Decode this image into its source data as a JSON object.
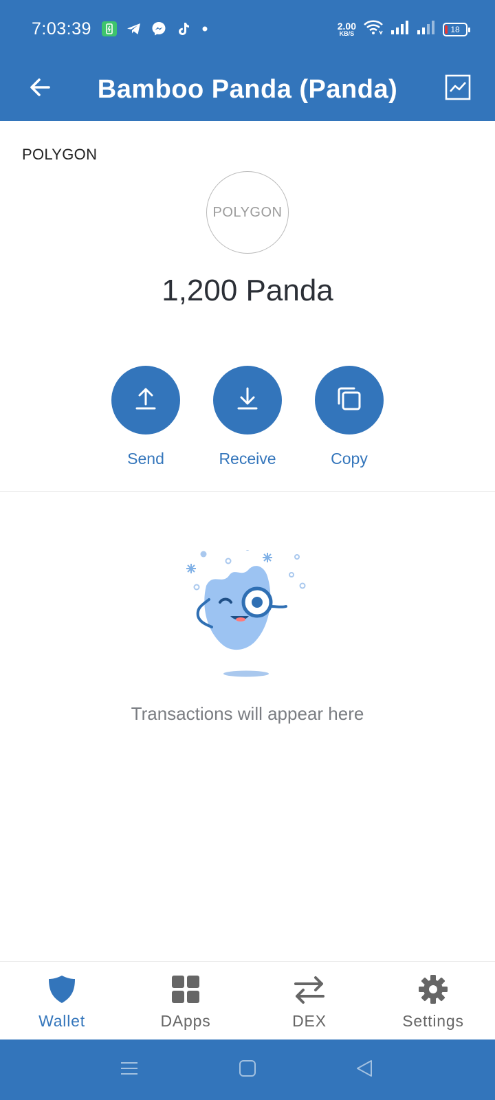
{
  "status_bar": {
    "time": "7:03:39",
    "net_speed_value": "2.00",
    "net_speed_unit": "KB/S",
    "battery": "18",
    "icons": [
      "battery-saver-icon",
      "telegram-icon",
      "messenger-icon",
      "tiktok-icon",
      "dot-icon",
      "wifi-icon",
      "signal-icon",
      "signal-icon"
    ]
  },
  "header": {
    "title": "Bamboo Panda (Panda)",
    "back_icon": "arrow-left-icon",
    "chart_icon": "chart-icon"
  },
  "token": {
    "network": "POLYGON",
    "logo_text": "POLYGON",
    "balance": "1,200 Panda"
  },
  "actions": [
    {
      "label": "Send",
      "icon": "upload-icon"
    },
    {
      "label": "Receive",
      "icon": "download-icon"
    },
    {
      "label": "Copy",
      "icon": "copy-icon"
    }
  ],
  "empty_state": {
    "message": "Transactions will appear here"
  },
  "bottom_nav": [
    {
      "label": "Wallet",
      "icon": "shield-icon",
      "active": true
    },
    {
      "label": "DApps",
      "icon": "grid-icon",
      "active": false
    },
    {
      "label": "DEX",
      "icon": "swap-icon",
      "active": false
    },
    {
      "label": "Settings",
      "icon": "gear-icon",
      "active": false
    }
  ],
  "colors": {
    "primary": "#3375bb",
    "text": "#2b2f36",
    "muted": "#7a7d82",
    "inactive": "#666666"
  }
}
